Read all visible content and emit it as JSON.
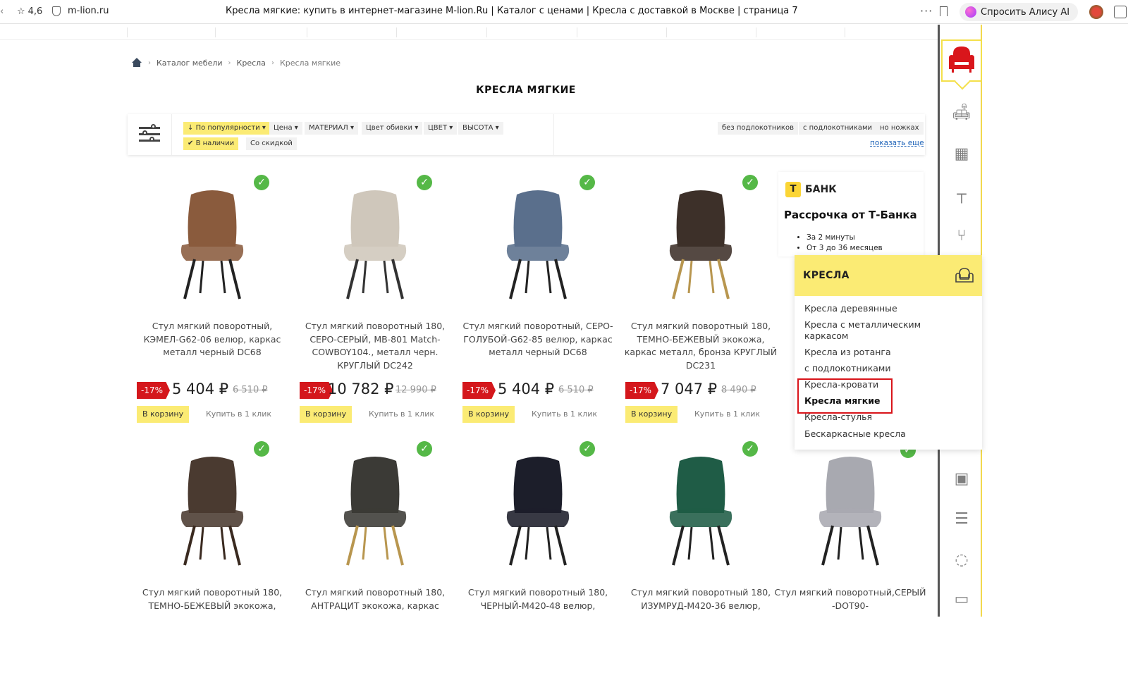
{
  "browser": {
    "rating": "4,6",
    "domain": "m-lion.ru",
    "tab_title": "Кресла мягкие: купить в интернет-магазине M-lion.Ru | Каталог с ценами | Кресла с доставкой в Москве | страница 7",
    "alice_label": "Спросить Алису AI"
  },
  "breadcrumb": [
    "Каталог мебели",
    "Кресла",
    "Кресла мягкие"
  ],
  "page_title": "КРЕСЛА МЯГКИЕ",
  "filters": {
    "sort": "По популярности",
    "price": "Цена",
    "material": "МАТЕРИАЛ",
    "upholstery": "Цвет обивки",
    "color": "ЦВЕТ",
    "height": "ВЫСОТА",
    "in_stock": "В наличии",
    "discount": "Со скидкой",
    "tags": [
      "без подлокотников",
      "с подлокотниками",
      "но ножках"
    ],
    "show_more": "показать еще"
  },
  "products": [
    {
      "name": "Стул мягкий поворотный, КЭМЕЛ-G62-06 велюр, каркас металл черный DC68",
      "discount": "-17%",
      "price": "5 404 ₽",
      "old_price": "6 510 ₽",
      "color": "#8a5b3d",
      "leg": "#222"
    },
    {
      "name": "Стул мягкий поворотный 180, СЕРО-СЕРЫЙ, MB-801 Match-COWBOY104., металл черн. КРУГЛЫЙ DC242",
      "discount": "-17%",
      "price": "10 782 ₽",
      "old_price": "12 990 ₽",
      "color": "#cfc7bb",
      "leg": "#333"
    },
    {
      "name": "Стул мягкий поворотный, СЕРО-ГОЛУБОЙ-G62-85 велюр, каркас металл черный DC68",
      "discount": "-17%",
      "price": "5 404 ₽",
      "old_price": "6 510 ₽",
      "color": "#5a6f8c",
      "leg": "#222"
    },
    {
      "name": "Стул мягкий поворотный 180, ТЕМНО-БЕЖЕВЫЙ экокожа, каркас металл, бронза КРУГЛЫЙ DC231",
      "discount": "-17%",
      "price": "7 047 ₽",
      "old_price": "8 490 ₽",
      "color": "#3d3029",
      "leg": "#b8964f"
    },
    {
      "name": "Стул мягкий поворотный 180, ТЕМНО-БЕЖЕВЫЙ экокожа,",
      "color": "#4a3a30",
      "leg": "#3a2a20"
    },
    {
      "name": "Стул мягкий поворотный 180, АНТРАЦИТ экокожа, каркас",
      "color": "#3b3a36",
      "leg": "#b8964f"
    },
    {
      "name": "Стул мягкий поворотный 180, ЧЕРНЫЙ-М420-48 велюр,",
      "color": "#1c1e2a",
      "leg": "#222"
    },
    {
      "name": "Стул мягкий поворотный 180, ИЗУМРУД-М420-36 велюр,",
      "color": "#1f5c46",
      "leg": "#222"
    },
    {
      "name": "Стул мягкий поворотный,СЕРЫЙ -DOT90-",
      "color": "#a8a9b0",
      "leg": "#222"
    }
  ],
  "cart_label": "В корзину",
  "oneclick_label": "Купить в 1 клик",
  "bank": {
    "logo_letter": "Т",
    "logo_text": "БАНК",
    "title": "Рассрочка от Т-Банка",
    "points": [
      "За 2 минуты",
      "От 3 до 36 месяцев"
    ]
  },
  "dropdown": {
    "header": "КРЕСЛА",
    "items": [
      "Кресла деревянные",
      "Кресла с металлическим каркасом",
      "Кресла из ротанга",
      "с подлокотниками",
      "Кресла-кровати",
      "Кресла мягкие",
      "Кресла-стулья",
      "Бескаркасные кресла"
    ]
  },
  "rail_icons": [
    "armchair-icon",
    "sofa-icon",
    "kitchen-icon",
    "table-icon",
    "chair-icon",
    "armchair-icon",
    "mattress-icon",
    "bed-icon",
    "dresser-icon",
    "wardrobe-icon",
    "fireplace-icon",
    "shelf-icon",
    "mirror-icon",
    "coffee-table-icon"
  ]
}
